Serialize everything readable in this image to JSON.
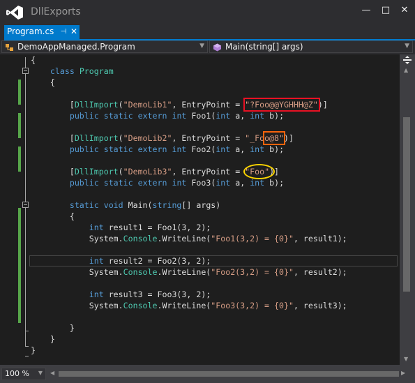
{
  "window": {
    "title": "DllExports",
    "minimize": "—",
    "maximize": "□",
    "close": "✕"
  },
  "tabs": {
    "active_label": "Program.cs",
    "pin": "⊣",
    "close": "✕"
  },
  "nav": {
    "type_dropdown": "DemoAppManaged.Program",
    "member_dropdown": "Main(string[] args)"
  },
  "code": {
    "lines": [
      "{",
      "    class Program",
      "    {",
      "",
      "        [DllImport(\"DemoLib1\", EntryPoint = \"?Foo@@YGHHH@Z\")]",
      "        public static extern int Foo1(int a, int b);",
      "",
      "        [DllImport(\"DemoLib2\", EntryPoint = \"_Foo@8\")]",
      "        public static extern int Foo2(int a, int b);",
      "",
      "        [DllImport(\"DemoLib3\", EntryPoint = \"Foo\")]",
      "        public static extern int Foo3(int a, int b);",
      "",
      "        static void Main(string[] args)",
      "        {",
      "            int result1 = Foo1(3, 2);",
      "            System.Console.WriteLine(\"Foo1(3,2) = {0}\", result1);",
      "",
      "            int result2 = Foo2(3, 2);",
      "            System.Console.WriteLine(\"Foo2(3,2) = {0}\", result2);",
      "",
      "            int result3 = Foo3(3, 2);",
      "            System.Console.WriteLine(\"Foo3(3,2) = {0}\", result3);",
      "",
      "        }",
      "    }",
      "}"
    ]
  },
  "statusbar": {
    "zoom": "100 %"
  },
  "colors": {
    "keyword": "#569cd6",
    "type": "#4ec9b0",
    "string": "#d69d85",
    "text": "#dcdcdc",
    "accent": "#007acc",
    "change_bar": "#57a64a",
    "highlight_red": "#e81123",
    "highlight_orange": "#f7630c",
    "highlight_yellow": "#ffd700"
  },
  "icons": [
    "visual-studio-logo-icon",
    "pin-icon",
    "close-icon",
    "dropdown-arrow-icon",
    "class-icon",
    "method-icon",
    "split-icon",
    "scroll-arrow-icon"
  ]
}
